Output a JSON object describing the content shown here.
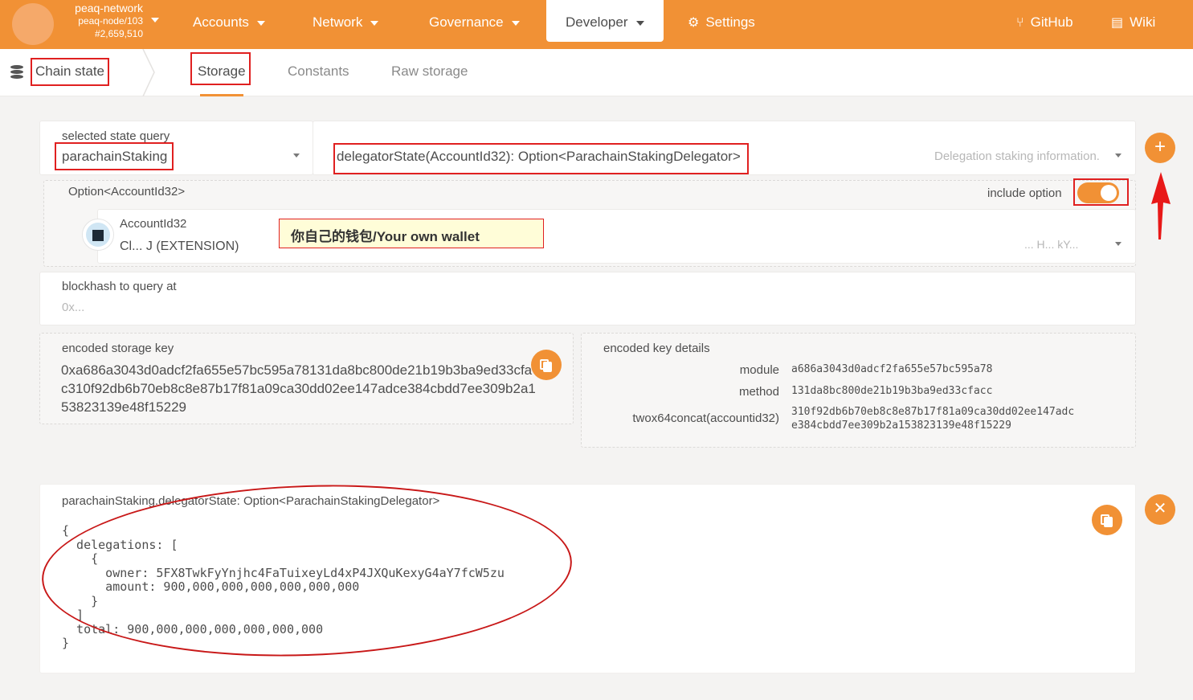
{
  "network": {
    "name": "peaq-network",
    "node": "peaq-node/103",
    "block": "#2,659,510"
  },
  "nav": {
    "accounts": "Accounts",
    "network": "Network",
    "governance": "Governance",
    "developer": "Developer",
    "settings": "Settings",
    "github": "GitHub",
    "wiki": "Wiki"
  },
  "subnav": {
    "title": "Chain state",
    "tabs": [
      "Storage",
      "Constants",
      "Raw storage"
    ]
  },
  "query": {
    "module_label": "selected state query",
    "module_value": "parachainStaking",
    "method_value": "delegatorState(AccountId32): Option<ParachainStakingDelegator>",
    "method_desc": "Delegation staking information.",
    "option_label": "Option<AccountId32>",
    "include_option_label": "include option",
    "include_option_on": true,
    "account_label": "AccountId32",
    "account_name": "Cl... J (EXTENSION)",
    "account_short": "... H... kY...",
    "annotation_note": "你自己的钱包/Your own wallet",
    "blockhash_label": "blockhash to query at",
    "blockhash_placeholder": "0x..."
  },
  "encoded": {
    "key_label": "encoded storage key",
    "key_lines": [
      "0xa686a3043d0adcf2fa655e57bc595a78131da8bc800de21b19b3ba9ed33cfa",
      "c310f92db6b70eb8c8e87b17f81a09ca30dd02ee147adce384cbdd7ee309b2a1",
      "53823139e48f15229"
    ],
    "details_label": "encoded key details",
    "details": [
      {
        "label": "module",
        "value": "a686a3043d0adcf2fa655e57bc595a78"
      },
      {
        "label": "method",
        "value": "131da8bc800de21b19b3ba9ed33cfacc"
      },
      {
        "label": "twox64concat(accountid32)",
        "value": "310f92db6b70eb8c8e87b17f81a09ca30dd02ee147adc\ne384cbdd7ee309b2a153823139e48f15229"
      }
    ]
  },
  "result": {
    "title": "parachainStaking.delegatorState: Option<ParachainStakingDelegator>",
    "json": "{\n  delegations: [\n    {\n      owner: 5FX8TwkFyYnjhc4FaTuixeyLd4xP4JXQuKexyG4aY7fcW5zu\n      amount: 900,000,000,000,000,000,000\n    }\n  ]\n  total: 900,000,000,000,000,000,000\n}"
  },
  "colors": {
    "accent": "#f19135",
    "annotation": "#e02020"
  }
}
